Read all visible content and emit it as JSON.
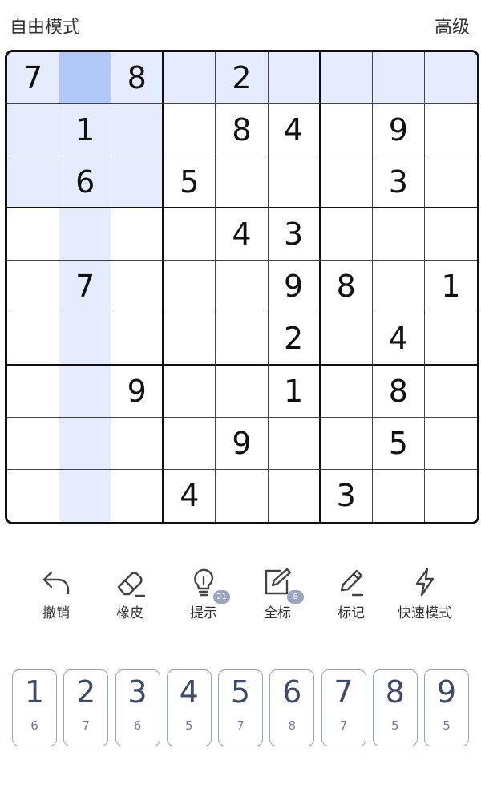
{
  "header": {
    "mode": "自由模式",
    "level": "高级"
  },
  "board": {
    "cells": [
      [
        "7",
        "",
        "8",
        "",
        "2",
        "",
        "",
        "",
        ""
      ],
      [
        "",
        "1",
        "",
        "",
        "8",
        "4",
        "",
        "9",
        ""
      ],
      [
        "",
        "6",
        "",
        "5",
        "",
        "",
        "",
        "3",
        ""
      ],
      [
        "",
        "",
        "",
        "",
        "4",
        "3",
        "",
        "",
        ""
      ],
      [
        "",
        "7",
        "",
        "",
        "",
        "9",
        "8",
        "",
        "1"
      ],
      [
        "",
        "",
        "",
        "",
        "",
        "2",
        "",
        "4",
        ""
      ],
      [
        "",
        "",
        "9",
        "",
        "",
        "1",
        "",
        "8",
        ""
      ],
      [
        "",
        "",
        "",
        "",
        "9",
        "",
        "",
        "5",
        ""
      ],
      [
        "",
        "",
        "",
        "4",
        "",
        "",
        "3",
        "",
        ""
      ]
    ],
    "selected": [
      0,
      1
    ],
    "highlight_color": "#e4ecfd",
    "selected_color": "#b0c9f9"
  },
  "toolbar": [
    {
      "label": "撤销",
      "icon": "undo-icon"
    },
    {
      "label": "橡皮",
      "icon": "eraser-icon"
    },
    {
      "label": "提示",
      "icon": "lightbulb-icon",
      "badge": "21"
    },
    {
      "label": "全标",
      "icon": "edit-all-icon",
      "badge": "8"
    },
    {
      "label": "标记",
      "icon": "pencil-icon"
    },
    {
      "label": "快速模式",
      "icon": "lightning-icon"
    }
  ],
  "keypad": [
    {
      "num": "1",
      "count": "6"
    },
    {
      "num": "2",
      "count": "7"
    },
    {
      "num": "3",
      "count": "6"
    },
    {
      "num": "4",
      "count": "5"
    },
    {
      "num": "5",
      "count": "7"
    },
    {
      "num": "6",
      "count": "8"
    },
    {
      "num": "7",
      "count": "7"
    },
    {
      "num": "8",
      "count": "5"
    },
    {
      "num": "9",
      "count": "5"
    }
  ]
}
